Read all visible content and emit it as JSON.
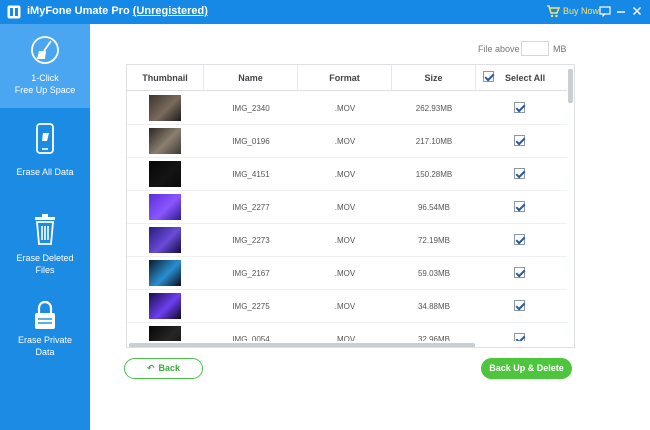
{
  "titlebar": {
    "app_name": "iMyFone Umate Pro",
    "registration": "(Unregistered)",
    "buy_now": "Buy Now",
    "logo_icon": "imyfone-logo-icon",
    "cart_icon": "cart-icon"
  },
  "sidebar": {
    "items": [
      {
        "label_line1": "1-Click",
        "label_line2": "Free Up Space",
        "icon": "broom-icon",
        "active": true
      },
      {
        "label_line1": "Erase All Data",
        "label_line2": "",
        "icon": "phone-erase-icon",
        "active": false
      },
      {
        "label_line1": "Erase Deleted",
        "label_line2": "Files",
        "icon": "trash-icon",
        "active": false
      },
      {
        "label_line1": "Erase Private",
        "label_line2": "Data",
        "icon": "lock-icon",
        "active": false
      }
    ]
  },
  "filter": {
    "label": "File above",
    "value": "",
    "unit": "MB"
  },
  "table": {
    "headers": {
      "thumbnail": "Thumbnail",
      "name": "Name",
      "format": "Format",
      "size": "Size",
      "select_all": "Select All"
    },
    "select_all_checked": true,
    "rows": [
      {
        "name": "IMG_2340",
        "format": ".MOV",
        "size": "262.93MB",
        "checked": true,
        "thumb": [
          "#3b3530",
          "#7a6a5c",
          "#1c1a18"
        ]
      },
      {
        "name": "IMG_0196",
        "format": ".MOV",
        "size": "217.10MB",
        "checked": true,
        "thumb": [
          "#2a2624",
          "#8c7f70",
          "#3c3836"
        ]
      },
      {
        "name": "IMG_4151",
        "format": ".MOV",
        "size": "150.28MB",
        "checked": true,
        "thumb": [
          "#050505",
          "#141414",
          "#0a0a0a"
        ]
      },
      {
        "name": "IMG_2277",
        "format": ".MOV",
        "size": "96.54MB",
        "checked": true,
        "thumb": [
          "#5b2fd8",
          "#8a56ff",
          "#2e1a8c"
        ]
      },
      {
        "name": "IMG_2273",
        "format": ".MOV",
        "size": "72.19MB",
        "checked": true,
        "thumb": [
          "#2a1a7a",
          "#6a4bd8",
          "#120a3a"
        ]
      },
      {
        "name": "IMG_2167",
        "format": ".MOV",
        "size": "59.03MB",
        "checked": true,
        "thumb": [
          "#0b1a2e",
          "#2a8fd0",
          "#0a0a14"
        ]
      },
      {
        "name": "IMG_2275",
        "format": ".MOV",
        "size": "34.88MB",
        "checked": true,
        "thumb": [
          "#1a0e4a",
          "#6d3ef0",
          "#0d0824"
        ]
      },
      {
        "name": "IMG_0054",
        "format": ".MOV",
        "size": "32.96MB",
        "checked": true,
        "thumb": [
          "#060606",
          "#262626",
          "#101010"
        ]
      }
    ]
  },
  "buttons": {
    "back": "Back",
    "back_up_delete": "Back Up & Delete"
  },
  "colors": {
    "titlebar": "#1689e6",
    "sidebar": "#1b8be4",
    "sidebar_active": "#4aa6f0",
    "accent_green": "#4dc53c"
  }
}
